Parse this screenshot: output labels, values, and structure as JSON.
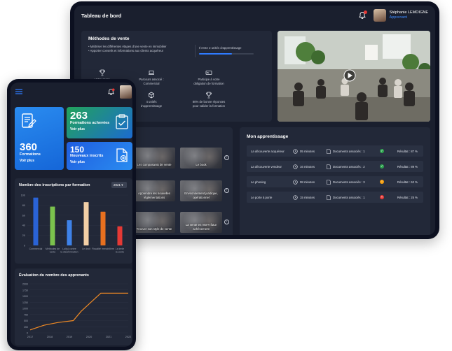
{
  "tablet": {
    "header_title": "Tableau de bord",
    "user_name": "Stéphanie LEMOIGNE",
    "user_role": "Apprenant",
    "methods": {
      "title": "Méthodes de vente",
      "bullets": [
        "Maîtriser les différentes étapes d'une vente en immobilier",
        "Apporter conseils et informations aux clients acquéreur"
      ],
      "remaining": "Il reste 2 unités d'apprentissage",
      "progress": 0.6,
      "features": [
        {
          "icon": "trophy-icon",
          "l1": "Votre score",
          "l2": ""
        },
        {
          "icon": "laptop-icon",
          "l1": "Parcours associé :",
          "l2": "Commercial"
        },
        {
          "icon": "id-card-icon",
          "l1": "Participe à votre",
          "l2": "obligation de formation"
        },
        {
          "icon": "cubes-icon",
          "l1": "4 unités",
          "l2": "d'apprentissage"
        },
        {
          "icon": "trophy-icon",
          "l1": "80% de bonne réponses",
          "l2": "pour valider la formation"
        }
      ]
    },
    "courses": [
      "Les composants de vente",
      "Le book",
      "Apprendre les nouvelles réglementations",
      "Environnement juridique, opérationnel",
      "Trouver son style de vente",
      "La vente en VEFA futur achèvement"
    ],
    "learning": {
      "title": "Mon apprentissage",
      "rows": [
        {
          "name": "La découverte acquéreur",
          "time": "05 minutes",
          "docs": "Documents associés : 1",
          "status": "ok",
          "result": "Résultat : 87 %"
        },
        {
          "name": "La découverte vendeur",
          "time": "16 minutes",
          "docs": "Documents associés : 2",
          "status": "ok",
          "result": "Résultat : 89 %"
        },
        {
          "name": "Le phoning",
          "time": "08 minutes",
          "docs": "Documents associés : 3",
          "status": "warn",
          "result": "Résultat : 62 %"
        },
        {
          "name": "Le porte à porte",
          "time": "15 minutes",
          "docs": "Documents associés : 1",
          "status": "fail",
          "result": "Résultat : 25 %"
        }
      ]
    }
  },
  "phone": {
    "cards": [
      {
        "num": "263",
        "label": "Formations achevées",
        "more": "Voir plus",
        "color": "#22a35a"
      },
      {
        "num": "360",
        "label": "Formations",
        "more": "Voir plus",
        "color": "#1566d8"
      },
      {
        "num": "150",
        "label": "Nouveaux inscrits",
        "more": "Voir plus",
        "color": "#1f5de0"
      }
    ],
    "chart1_title": "Nombre des inscriptions par formation",
    "year": "2021",
    "chart2_title": "Évaluation du nombre des apprenants"
  },
  "chart_data": [
    {
      "type": "bar",
      "title": "Nombre des inscriptions par formation",
      "categories": [
        "Commercial",
        "Méthodes de vente",
        "Loi(s) contre la discrimination",
        "Le droit",
        "Fiscalité immobilière",
        "La lente la vente"
      ],
      "values": [
        95,
        77,
        50,
        86,
        67,
        38
      ],
      "colors": [
        "#2a63d6",
        "#7bc24d",
        "#3e82e8",
        "#f2cfa6",
        "#e8701f",
        "#e53935"
      ],
      "yticks": [
        "100",
        "80",
        "60",
        "40",
        "20",
        "0"
      ],
      "ylim": [
        0,
        100
      ]
    },
    {
      "type": "line",
      "title": "Évaluation du nombre des apprenants",
      "x": [
        "2017",
        "2018",
        "2019",
        "2020",
        "2021",
        "2022"
      ],
      "values": [
        120,
        310,
        420,
        500,
        880,
        1620,
        1620
      ],
      "xpos": [
        0,
        0.7,
        1.4,
        2.2,
        2.6,
        3.6,
        5.0
      ],
      "yticks": [
        "2000",
        "1750",
        "1500",
        "1250",
        "1000",
        "750",
        "500",
        "250",
        "0"
      ],
      "ylim": [
        0,
        2000
      ]
    }
  ]
}
